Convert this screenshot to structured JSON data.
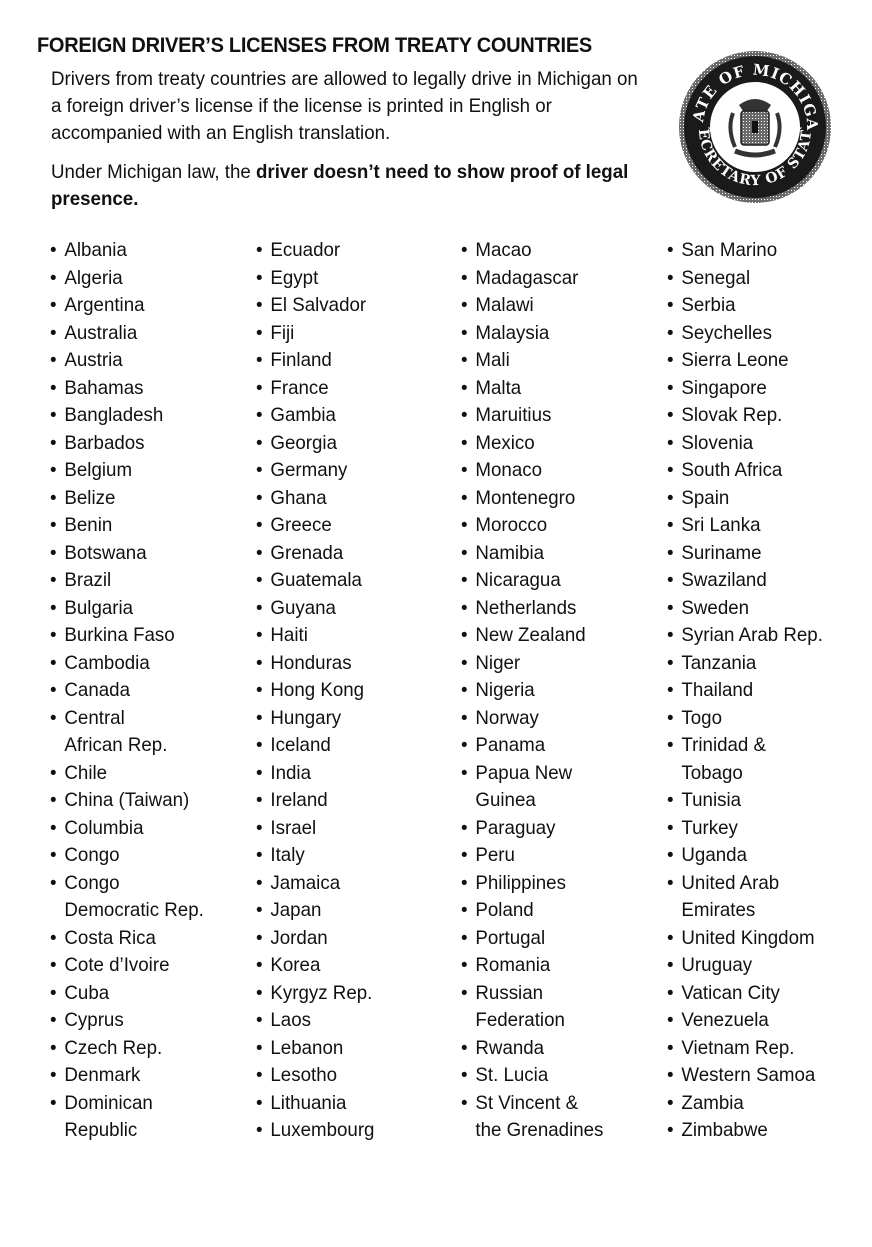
{
  "document": {
    "title": "FOREIGN DRIVER’S LICENSES FROM TREATY COUNTRIES",
    "intro_paragraph": "Drivers from treaty countries are allowed to legally drive in Michigan on a foreign driver’s license if the license is printed in English or accompanied with an English translation.",
    "law_prefix": "Under Michigan law, the ",
    "law_bold": "driver doesn’t need to show proof of legal presence.",
    "seal": {
      "icon": "michigan-secretary-of-state-seal",
      "top_text": "STATE OF MICHIGAN",
      "bottom_text": "SECRETARY OF STATE"
    }
  },
  "countries": {
    "columns": [
      [
        [
          "Albania"
        ],
        [
          "Algeria"
        ],
        [
          "Argentina"
        ],
        [
          "Australia"
        ],
        [
          "Austria"
        ],
        [
          "Bahamas"
        ],
        [
          "Bangladesh"
        ],
        [
          "Barbados"
        ],
        [
          "Belgium"
        ],
        [
          "Belize"
        ],
        [
          "Benin"
        ],
        [
          "Botswana"
        ],
        [
          "Brazil"
        ],
        [
          "Bulgaria"
        ],
        [
          "Burkina Faso"
        ],
        [
          "Cambodia"
        ],
        [
          "Canada"
        ],
        [
          "Central",
          "African Rep."
        ],
        [
          "Chile"
        ],
        [
          "China (Taiwan)"
        ],
        [
          "Columbia"
        ],
        [
          "Congo"
        ],
        [
          "Congo",
          "Democratic Rep."
        ],
        [
          "Costa Rica"
        ],
        [
          "Cote d’Ivoire"
        ],
        [
          "Cuba"
        ],
        [
          "Cyprus"
        ],
        [
          "Czech Rep."
        ],
        [
          "Denmark"
        ],
        [
          "Dominican",
          "Republic"
        ]
      ],
      [
        [
          "Ecuador"
        ],
        [
          "Egypt"
        ],
        [
          "El Salvador"
        ],
        [
          "Fiji"
        ],
        [
          "Finland"
        ],
        [
          "France"
        ],
        [
          "Gambia"
        ],
        [
          "Georgia"
        ],
        [
          "Germany"
        ],
        [
          "Ghana"
        ],
        [
          "Greece"
        ],
        [
          "Grenada"
        ],
        [
          "Guatemala"
        ],
        [
          "Guyana"
        ],
        [
          "Haiti"
        ],
        [
          "Honduras"
        ],
        [
          "Hong Kong"
        ],
        [
          "Hungary"
        ],
        [
          "Iceland"
        ],
        [
          "India"
        ],
        [
          "Ireland"
        ],
        [
          "Israel"
        ],
        [
          "Italy"
        ],
        [
          "Jamaica"
        ],
        [
          "Japan"
        ],
        [
          "Jordan"
        ],
        [
          "Korea"
        ],
        [
          "Kyrgyz Rep."
        ],
        [
          "Laos"
        ],
        [
          "Lebanon"
        ],
        [
          "Lesotho"
        ],
        [
          "Lithuania"
        ],
        [
          "Luxembourg"
        ]
      ],
      [
        [
          "Macao"
        ],
        [
          "Madagascar"
        ],
        [
          "Malawi"
        ],
        [
          "Malaysia"
        ],
        [
          "Mali"
        ],
        [
          "Malta"
        ],
        [
          "Maruitius"
        ],
        [
          "Mexico"
        ],
        [
          "Monaco"
        ],
        [
          "Montenegro"
        ],
        [
          "Morocco"
        ],
        [
          "Namibia"
        ],
        [
          "Nicaragua"
        ],
        [
          "Netherlands"
        ],
        [
          "New Zealand"
        ],
        [
          "Niger"
        ],
        [
          "Nigeria"
        ],
        [
          "Norway"
        ],
        [
          "Panama"
        ],
        [
          "Papua New",
          "Guinea"
        ],
        [
          "Paraguay"
        ],
        [
          "Peru"
        ],
        [
          "Philippines"
        ],
        [
          "Poland"
        ],
        [
          "Portugal"
        ],
        [
          "Romania"
        ],
        [
          "Russian",
          "Federation"
        ],
        [
          "Rwanda"
        ],
        [
          "St. Lucia"
        ],
        [
          "St Vincent &",
          "the Grenadines"
        ]
      ],
      [
        [
          "San Marino"
        ],
        [
          "Senegal"
        ],
        [
          "Serbia"
        ],
        [
          "Seychelles"
        ],
        [
          "Sierra Leone"
        ],
        [
          "Singapore"
        ],
        [
          "Slovak Rep."
        ],
        [
          "Slovenia"
        ],
        [
          "South Africa"
        ],
        [
          "Spain"
        ],
        [
          "Sri Lanka"
        ],
        [
          "Suriname"
        ],
        [
          "Swaziland"
        ],
        [
          "Sweden"
        ],
        [
          "Syrian Arab Rep."
        ],
        [
          "Tanzania"
        ],
        [
          "Thailand"
        ],
        [
          "Togo"
        ],
        [
          "Trinidad &",
          "Tobago"
        ],
        [
          "Tunisia"
        ],
        [
          "Turkey"
        ],
        [
          "Uganda"
        ],
        [
          "United Arab",
          "Emirates"
        ],
        [
          "United Kingdom"
        ],
        [
          "Uruguay"
        ],
        [
          "Vatican City"
        ],
        [
          "Venezuela"
        ],
        [
          "Vietnam Rep."
        ],
        [
          "Western Samoa"
        ],
        [
          "Zambia"
        ],
        [
          "Zimbabwe"
        ]
      ]
    ]
  }
}
